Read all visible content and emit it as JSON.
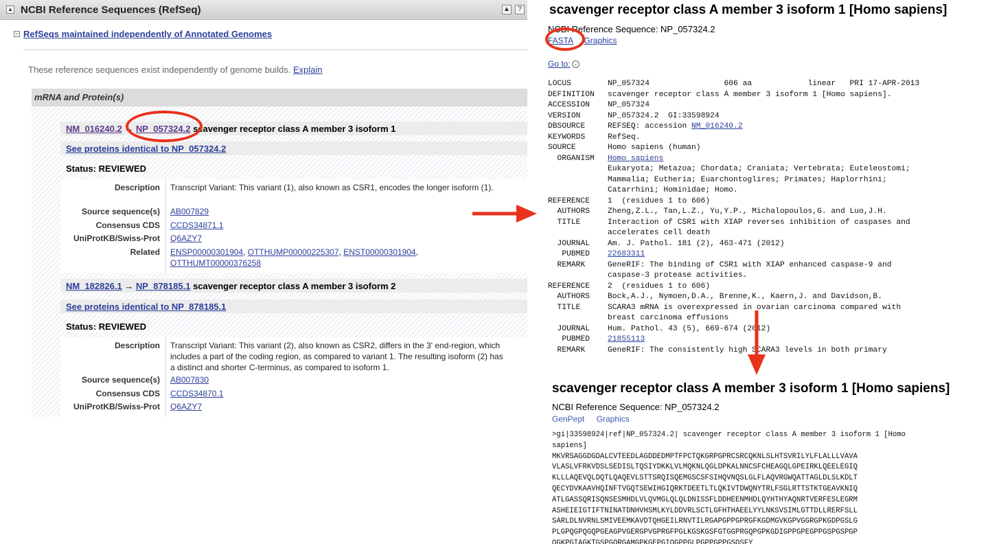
{
  "left": {
    "title": "NCBI Reference Sequences (RefSeq)",
    "collapse_icon": "▲",
    "expand_icon": "▲",
    "expand_icon_lower": "≈",
    "help_icon": "?",
    "section_toggle": "−",
    "section_title": "RefSeqs maintained independently of Annotated Genomes",
    "intro": "These reference sequences exist independently of genome builds.",
    "intro_link": "Explain",
    "box_header": "mRNA and Protein(s)",
    "records": [
      {
        "mrna": "NM_016240.2",
        "arrow": "→",
        "protein": "NP_057324.2",
        "name": "scavenger receptor class A member 3 isoform 1",
        "identical": "See proteins identical to NP_057324.2",
        "status": "Status: REVIEWED",
        "rows": [
          {
            "label": "Description",
            "value": "Transcript Variant: This variant (1), also known as CSR1, encodes the longer isoform (1)."
          },
          {
            "label": "Source sequence(s)",
            "links": [
              "AB007829"
            ]
          },
          {
            "label": "Consensus CDS",
            "links": [
              "CCDS34871.1"
            ]
          },
          {
            "label": "UniProtKB/Swiss-Prot",
            "links": [
              "Q6AZY7"
            ]
          },
          {
            "label": "Related",
            "links": [
              "ENSP00000301904",
              "OTTHUMP00000225307",
              "ENST00000301904",
              "OTTHUMT00000376258"
            ]
          }
        ]
      },
      {
        "mrna": "NM_182826.1",
        "arrow": "→",
        "protein": "NP_878185.1",
        "name": "scavenger receptor class A member 3 isoform 2",
        "identical": "See proteins identical to NP_878185.1",
        "status": "Status: REVIEWED",
        "rows": [
          {
            "label": "Description",
            "value": "Transcript Variant: This variant (2), also known as CSR2, differs in the 3' end-region, which includes a part of the coding region, as compared to variant 1. The resulting isoform (2) has a distinct and shorter C-terminus, as compared to isoform 1."
          },
          {
            "label": "Source sequence(s)",
            "links": [
              "AB007830"
            ]
          },
          {
            "label": "Consensus CDS",
            "links": [
              "CCDS34870.1"
            ]
          },
          {
            "label": "UniProtKB/Swiss-Prot",
            "links": [
              "Q6AZY7"
            ]
          }
        ]
      }
    ]
  },
  "genpept": {
    "title": "scavenger receptor class A member 3 isoform 1 [Homo sapiens]",
    "subtitle": "NCBI Reference Sequence: NP_057324.2",
    "links": [
      "FASTA",
      "Graphics"
    ],
    "goto": "Go to:",
    "goto_icon": "⌄",
    "lines": [
      {
        "k": "LOCUS",
        "v": "NP_057324                606 aa            linear   PRI 17-APR-2013"
      },
      {
        "k": "DEFINITION",
        "v": "scavenger receptor class A member 3 isoform 1 [Homo sapiens]."
      },
      {
        "k": "ACCESSION",
        "v": "NP_057324"
      },
      {
        "k": "VERSION",
        "v": "NP_057324.2  GI:33598924"
      },
      {
        "k": "DBSOURCE",
        "v": "REFSEQ: accession ",
        "link": "NM_016240.2"
      },
      {
        "k": "KEYWORDS",
        "v": "RefSeq."
      },
      {
        "k": "SOURCE",
        "v": "Homo sapiens (human)"
      },
      {
        "k": "  ORGANISM",
        "v": "",
        "link": "Homo sapiens"
      },
      {
        "k": "",
        "v": "Eukaryota; Metazoa; Chordata; Craniata; Vertebrata; Euteleostomi;"
      },
      {
        "k": "",
        "v": "Mammalia; Eutheria; Euarchontoglires; Primates; Haplorrhini;"
      },
      {
        "k": "",
        "v": "Catarrhini; Hominidae; Homo."
      },
      {
        "k": "REFERENCE",
        "v": "1  (residues 1 to 606)"
      },
      {
        "k": "  AUTHORS",
        "v": "Zheng,Z.L., Tan,L.Z., Yu,Y.P., Michalopoulos,G. and Luo,J.H."
      },
      {
        "k": "  TITLE",
        "v": "Interaction of CSR1 with XIAP reverses inhibition of caspases and"
      },
      {
        "k": "",
        "v": "accelerates cell death"
      },
      {
        "k": "  JOURNAL",
        "v": "Am. J. Pathol. 181 (2), 463-471 (2012)"
      },
      {
        "k": "   PUBMED",
        "v": "",
        "link": "22683311"
      },
      {
        "k": "  REMARK",
        "v": "GeneRIF: The binding of CSR1 with XIAP enhanced caspase-9 and"
      },
      {
        "k": "",
        "v": "caspase-3 protease activities."
      },
      {
        "k": "REFERENCE",
        "v": "2  (residues 1 to 606)"
      },
      {
        "k": "  AUTHORS",
        "v": "Bock,A.J., Nymoen,D.A., Brenne,K., Kaern,J. and Davidson,B."
      },
      {
        "k": "  TITLE",
        "v": "SCARA3 mRNA is overexpressed in ovarian carcinoma compared with"
      },
      {
        "k": "",
        "v": "breast carcinoma effusions"
      },
      {
        "k": "  JOURNAL",
        "v": "Hum. Pathol. 43 (5), 669-674 (2012)"
      },
      {
        "k": "   PUBMED",
        "v": "",
        "link": "21855113"
      },
      {
        "k": "  REMARK",
        "v": "GeneRIF: The consistently high SCARA3 levels in both primary"
      }
    ]
  },
  "fasta": {
    "title": "scavenger receptor class A member 3 isoform 1 [Homo sapiens]",
    "subtitle": "NCBI Reference Sequence: NP_057324.2",
    "links": [
      "GenPept",
      "Graphics"
    ],
    "lines": [
      ">gi|33598924|ref|NP_057324.2| scavenger receptor class A member 3 isoform 1 [Homo",
      "sapiens]",
      "MKVRSAGGDGDALCVTEEDLAGDDEDMPTFPCTQKGRPGPRCSRCQKNLSLHTSVRILYLFLALLLVAVA",
      "VLASLVFRKVDSLSEDISLTQSIYDKKLVLMQKNLQGLDPKALNNCSFCHEAGQLGPEIRKLQEELEGIQ",
      "KLLLAQEVQLDQTLQAQEVLSTTSRQISQEMGSCSFSIHQVNQSLGLFLAQVRGWQATTAGLDLSLKDLT",
      "QECYDVKAAVHQINFTVGQTSEWIHGIQRKTDEETLTLQKIVTDWQNYTRLFSGLRTTSTKTGEAVKNIQ",
      "ATLGASSQRISQNSESMHDLVLQVMGLQLQLDNISSFLDDHEENMHDLQYHTHYAQNRTVERFESLEGRM",
      "ASHEIEIGTIFTNINATDNHVHSMLKYLDDVRLSCTLGFHTHAEELYYLNKSVSIMLGTTDLLRERFSLL",
      "SARLDLNVRNLSMIVEEMKAVDTQHGEILRNVTILRGAPGPPGPRGFKGDMGVKGPVGGRGPKGDPGSLG",
      "PLGPQGPQGQPGEAGPVGERGPVGPRGFPGLKGSKGSFGTGGPRGQPGPKGDIGPPGPEGPPGSPGSPGP",
      "QGKPGIAGKTGSPGQRGAMGPKGEPGIQGPPGLPGPPGPPGSQSFY"
    ]
  },
  "colors": {
    "annotation": "#e8321b",
    "link": "#2b3f9b",
    "visited": "#5b3b8e",
    "header_bg": "#dcdcdc"
  }
}
